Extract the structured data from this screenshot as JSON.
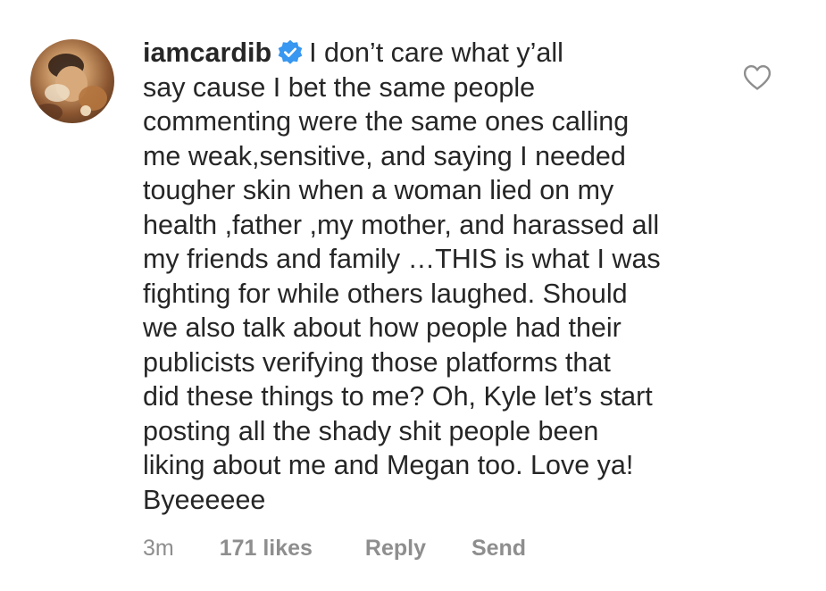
{
  "comment": {
    "username": "iamcardib",
    "verified_icon": "verified-badge-icon",
    "text_lines": [
      "I don’t care what y’all",
      "say cause I bet the same people",
      "commenting were the same ones calling",
      "me weak,sensitive, and saying I needed",
      "tougher skin when a woman lied on my",
      "health ,father ,my mother, and harassed all",
      "my friends and family …THIS is what I was",
      "fighting for while others laughed. Should",
      "we also talk about how people had their",
      "publicists verifying those platforms that",
      "did these things to me? Oh, Kyle let’s start",
      "posting all the shady shit people been",
      "liking about me and Megan too. Love ya!",
      "Byeeeeee"
    ],
    "time": "3m",
    "likes": "171 likes",
    "reply_label": "Reply",
    "send_label": "Send",
    "like_icon": "heart-outline-icon"
  },
  "colors": {
    "text": "#262626",
    "meta": "#8e8e8e",
    "verified": "#3897f0"
  }
}
